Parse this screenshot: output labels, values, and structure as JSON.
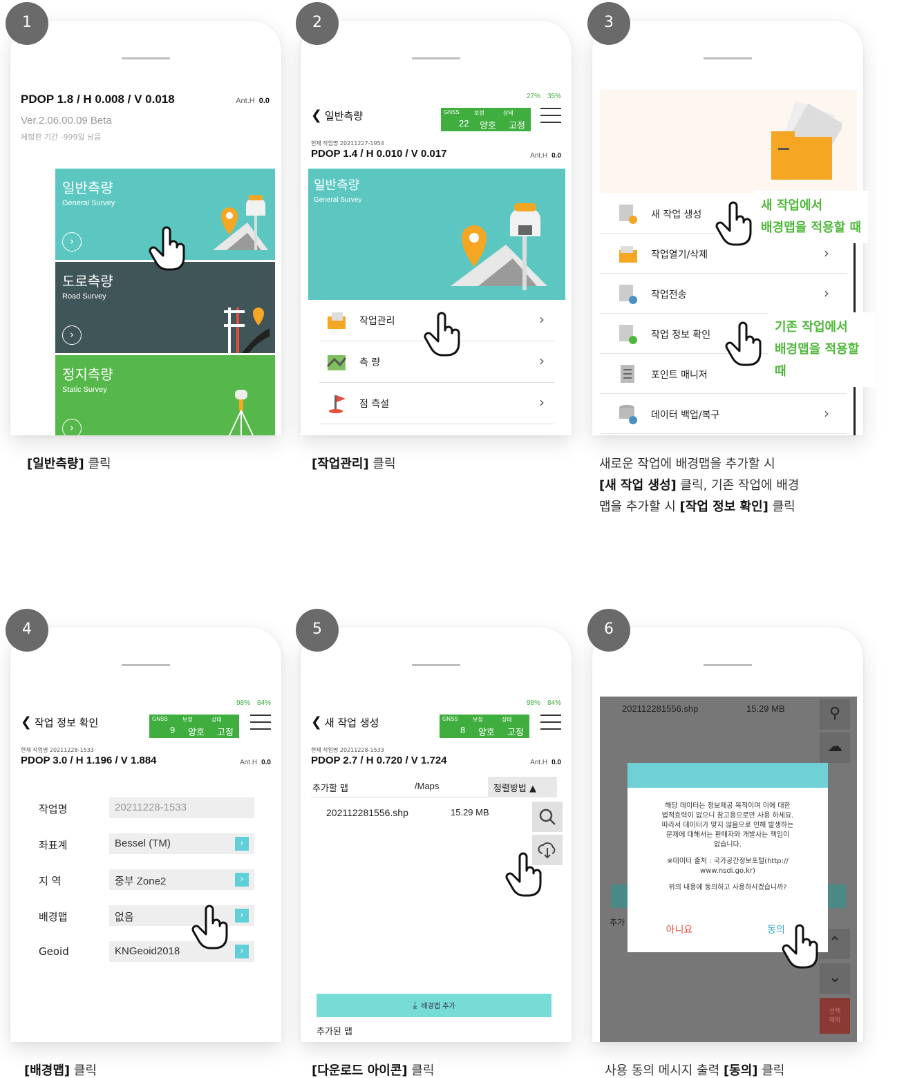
{
  "colors": {
    "teal": "#5cc7c1",
    "dark_slate": "#3f5557",
    "green": "#4fb83a",
    "gnss_green": "#3fae3f",
    "accent_red": "#e84c3d",
    "note_green": "#4fb83a"
  },
  "step1": {
    "badge": "1",
    "pdop": "PDOP 1.8 / H 0.008 / V 0.018",
    "ant_label": "Ant.H",
    "ant_value": "0.0",
    "version": "Ver.2.06.00.09 Beta",
    "trial": "체험판 기간 -999일 남음",
    "tiles": [
      {
        "ko": "일반측량",
        "en": "General Survey"
      },
      {
        "ko": "도로측량",
        "en": "Road Survey"
      },
      {
        "ko": "정지측량",
        "en": "Static Survey"
      }
    ],
    "caption_bold": "[일반측량]",
    "caption_rest": " 클릭"
  },
  "step2": {
    "badge": "2",
    "battery1": "27%",
    "battery2": "35%",
    "back_title": "일반측량",
    "gnss": {
      "l1": "GNSS",
      "v1": "22",
      "l2": "보정",
      "v2": "양호",
      "l3": "상태",
      "v3": "고정"
    },
    "current_job": "현재 작업명 20211227-1954",
    "pdop": "PDOP 1.4 / H 0.010 / V 0.017",
    "ant_label": "Ant.H",
    "ant_value": "0.0",
    "hero_ko": "일반측량",
    "hero_en": "General Survey",
    "menu": [
      "작업관리",
      "측 량",
      "점 측설"
    ],
    "caption_bold": "[작업관리]",
    "caption_rest": " 클릭"
  },
  "step3": {
    "badge": "3",
    "menu": [
      "새 작업 생성",
      "작업열기/삭제",
      "작업전송",
      "작업 정보 확인",
      "포인트 매니저",
      "데이터 백업/복구"
    ],
    "note1_line1": "새 작업에서",
    "note1_line2": "배경맵을 적용할 때",
    "note2_line1": "기존 작업에서",
    "note2_line2": "배경맵을 적용할 때",
    "caption_l1": "새로운 작업에 배경맵을 추가할 시",
    "caption_l2_bold": "[새 작업 생성]",
    "caption_l2_rest": " 클릭, 기존 작업에 배경",
    "caption_l3_pre": "맵을 추가할 시 ",
    "caption_l3_bold": "[작업 정보 확인]",
    "caption_l3_rest": " 클릭"
  },
  "step4": {
    "badge": "4",
    "battery1": "98%",
    "battery2": "84%",
    "back_title": "작업 정보 확인",
    "gnss": {
      "l1": "GNSS",
      "v1": "9",
      "l2": "보정",
      "v2": "양호",
      "l3": "상태",
      "v3": "고정"
    },
    "current_job": "현재 작업명 20211228-1533",
    "pdop": "PDOP 3.0 / H 1.196 / V 1.884",
    "ant_label": "Ant.H",
    "ant_value": "0.0",
    "fields": [
      {
        "label": "작업명",
        "value": "20211228-1533"
      },
      {
        "label": "좌표계",
        "value": "Bessel (TM)"
      },
      {
        "label": "지 역",
        "value": "중부 Zone2"
      },
      {
        "label": "배경맵",
        "value": "없음"
      },
      {
        "label": "Geoid",
        "value": "KNGeoid2018"
      }
    ],
    "caption_bold": "[배경맵]",
    "caption_rest": " 클릭"
  },
  "step5": {
    "badge": "5",
    "battery1": "98%",
    "battery2": "84%",
    "back_title": "새 작업 생성",
    "gnss": {
      "l1": "GNSS",
      "v1": "8",
      "l2": "보정",
      "v2": "양호",
      "l3": "상태",
      "v3": "고정"
    },
    "current_job": "현재 작업명 20211228-1533",
    "pdop": "PDOP 2.7 / H 0.720 / V 1.724",
    "ant_label": "Ant.H",
    "ant_value": "0.0",
    "col_add": "추가할 맵",
    "col_path": "/Maps",
    "col_sort": "정렬방법 ▲",
    "file_name": "202112281556.shp",
    "file_size": "15.29 MB",
    "add_button": "배경맵 추가",
    "added_label": "추가된 맵",
    "caption_bold": "[다운로드 아이콘]",
    "caption_rest": " 클릭"
  },
  "step6": {
    "badge": "6",
    "file_name": "202112281556.shp",
    "file_size": "15.29 MB",
    "add_partial": "추가",
    "deselect": "선택\n제외",
    "dialog_l1": "해당 데이터는 정보제공 목적이며 이에 대한",
    "dialog_l2": "법적효력이 없으니 참고용으로만 사용 하세요.",
    "dialog_l3": "따라서 데이터가 맞지 않음으로 인해 발생하는",
    "dialog_l4": "문제에 대해서는 판매자와 개발사는 책임이",
    "dialog_l5": "없습니다.",
    "dialog_src1": "※데이터 출처 : 국가공간정보포털(http://",
    "dialog_src2": "www.nsdi.go.kr)",
    "dialog_q": "위의 내용에 동의하고 사용하시겠습니까?",
    "btn_no": "아니요",
    "btn_yes": "동의",
    "caption_pre": "사용 동의 메시지 출력 ",
    "caption_bold": "[동의]",
    "caption_rest": " 클릭"
  }
}
